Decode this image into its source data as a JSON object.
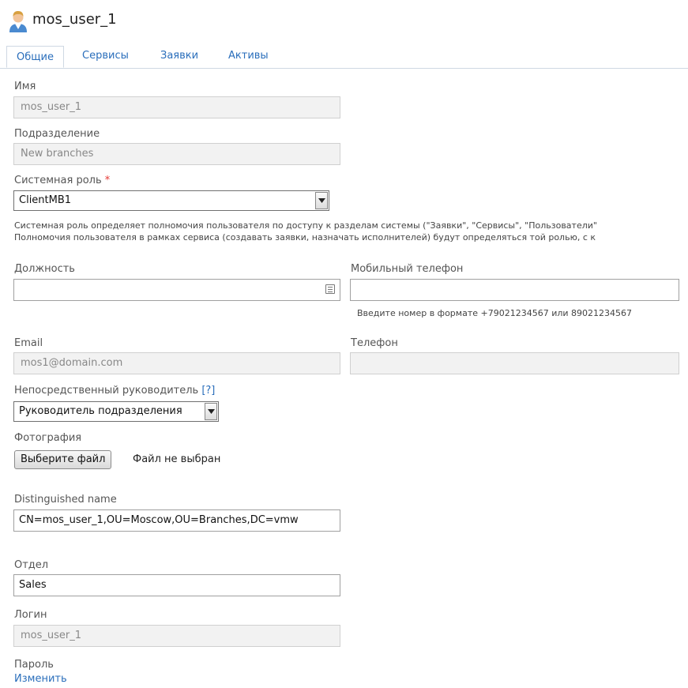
{
  "header": {
    "title": "mos_user_1",
    "icon": "user-icon"
  },
  "tabs": [
    {
      "label": "Общие",
      "active": true
    },
    {
      "label": "Сервисы",
      "active": false
    },
    {
      "label": "Заявки",
      "active": false
    },
    {
      "label": "Активы",
      "active": false
    }
  ],
  "form": {
    "name": {
      "label": "Имя",
      "value": "mos_user_1"
    },
    "department": {
      "label": "Подразделение",
      "value": "New branches"
    },
    "system_role": {
      "label": "Системная роль",
      "required_mark": "*",
      "value": "ClientMB1",
      "hint_line1": "Системная роль определяет полномочия пользователя по доступу к разделам системы (\"Заявки\", \"Сервисы\", \"Пользователи\"",
      "hint_line2": "Полномочия пользователя в рамках сервиса (создавать заявки, назначать исполнителей) будут определяться той ролью, с к"
    },
    "position": {
      "label": "Должность",
      "value": ""
    },
    "mobile_phone": {
      "label": "Мобильный телефон",
      "value": "",
      "hint": "Введите номер в формате +79021234567 или 89021234567"
    },
    "email": {
      "label": "Email",
      "value": "mos1@domain.com"
    },
    "phone": {
      "label": "Телефон",
      "value": ""
    },
    "manager": {
      "label": "Непосредственный руководитель",
      "help_link": "[?]",
      "value": "Руководитель подразделения"
    },
    "photo": {
      "label": "Фотография",
      "button_label": "Выберите файл",
      "status": "Файл не выбран"
    },
    "distinguished_name": {
      "label": "Distinguished name",
      "value": "CN=mos_user_1,OU=Moscow,OU=Branches,DC=vmw"
    },
    "division": {
      "label": "Отдел",
      "value": "Sales"
    },
    "login": {
      "label": "Логин",
      "value": "mos_user_1"
    },
    "password": {
      "label": "Пароль",
      "change_link": "Изменить"
    }
  },
  "colors": {
    "accent": "#2a6ebb",
    "required": "#e53935",
    "readonly_bg": "#f2f2f2"
  }
}
